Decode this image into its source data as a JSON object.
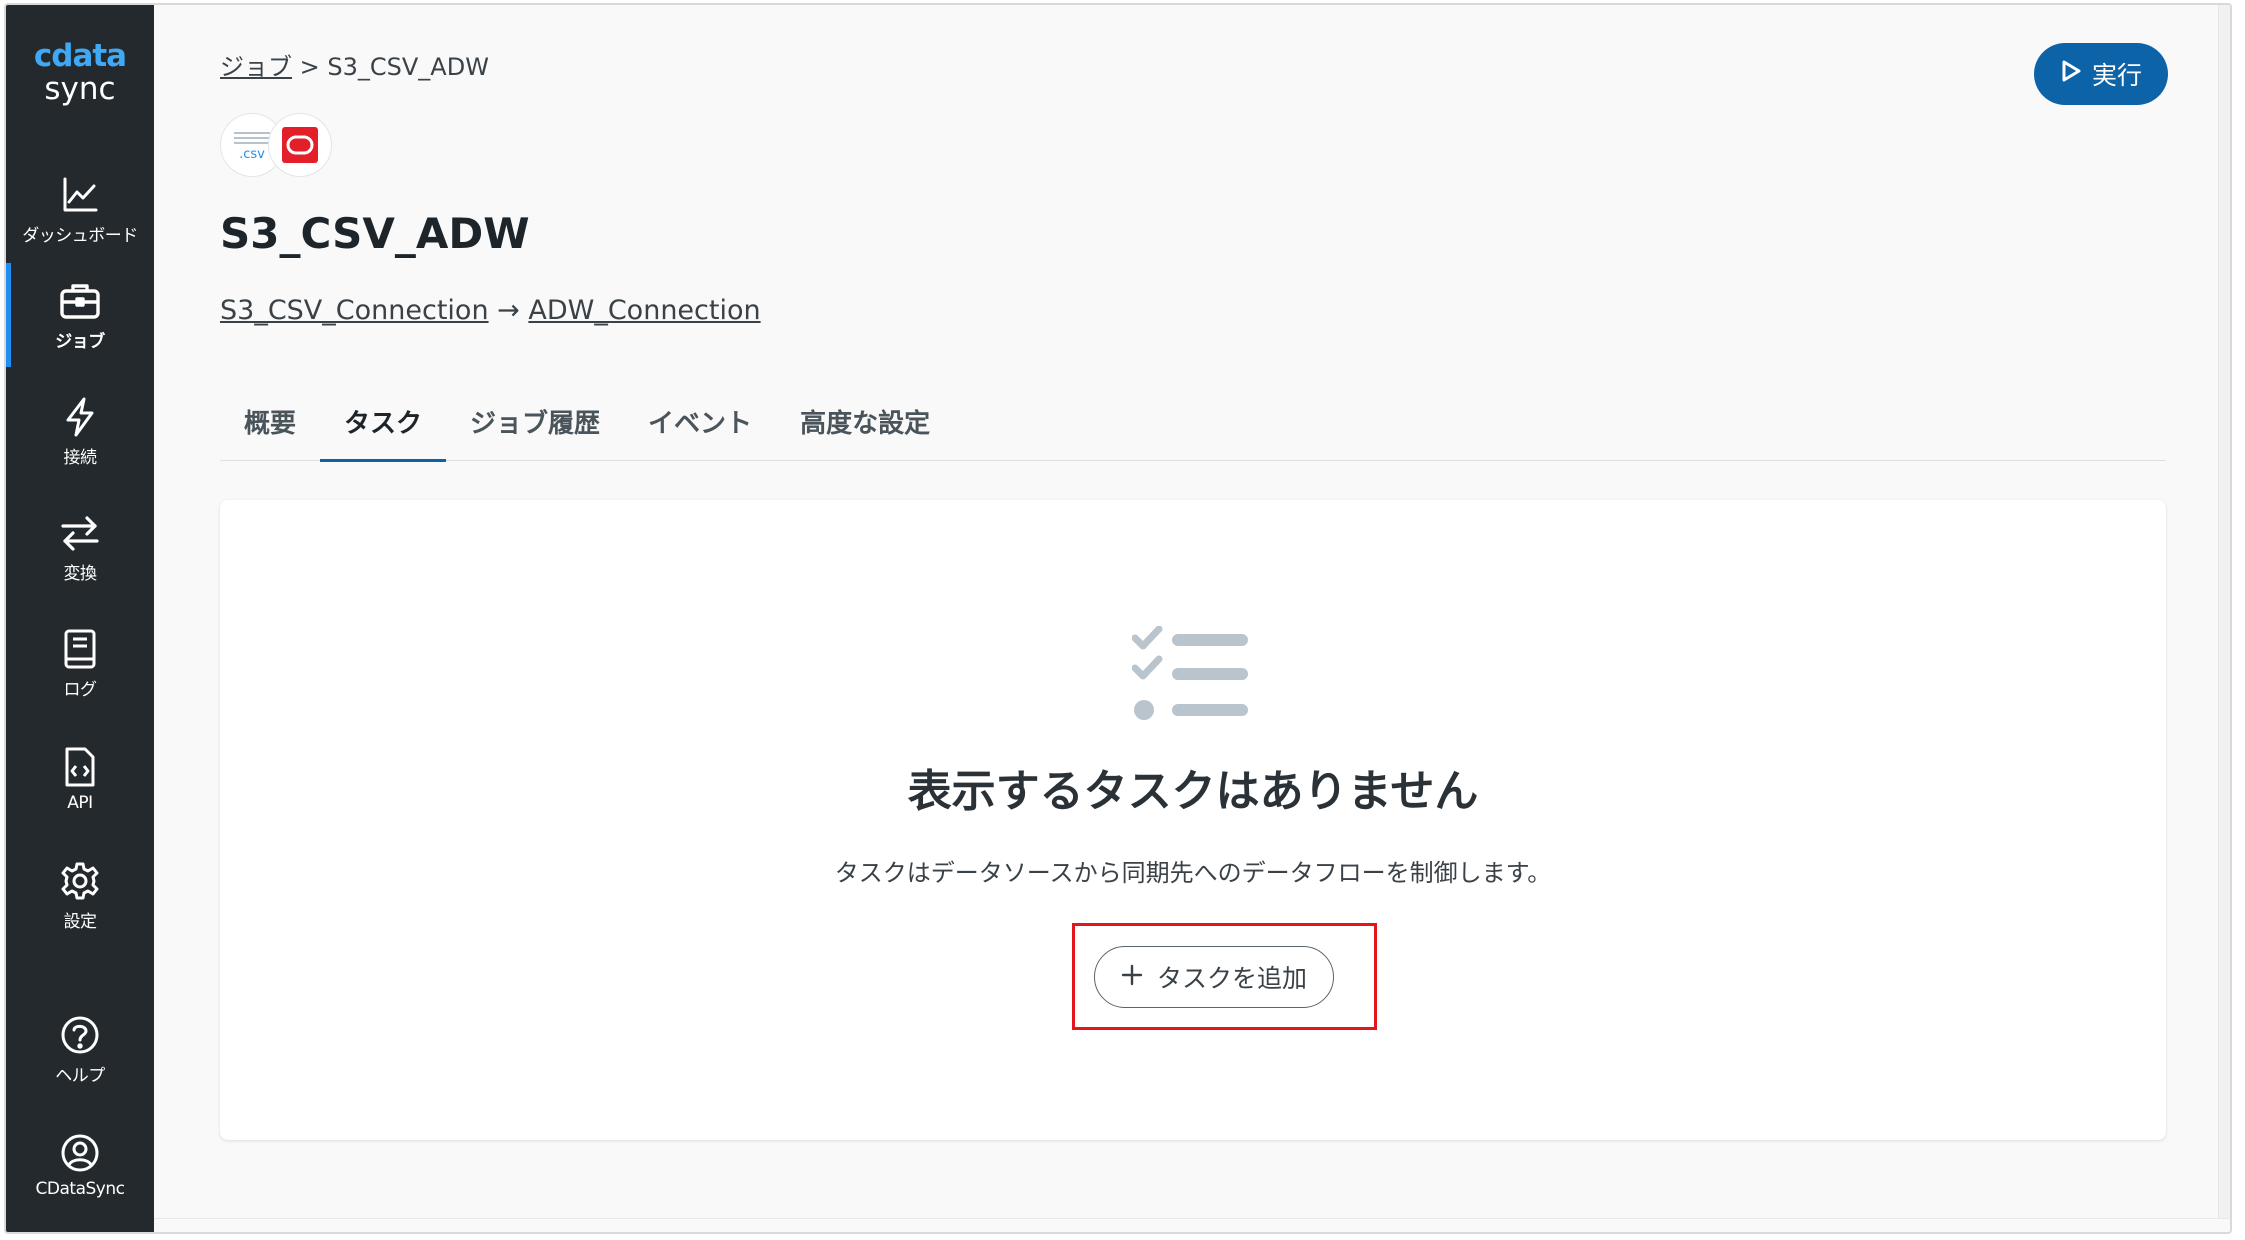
{
  "app": {
    "logo_brand": "cdata",
    "logo_sub": "sync"
  },
  "sidebar": {
    "items": [
      {
        "label": "ダッシュボード",
        "icon": "chart-line-icon"
      },
      {
        "label": "ジョブ",
        "icon": "briefcase-icon",
        "active": true
      },
      {
        "label": "接続",
        "icon": "lightning-icon"
      },
      {
        "label": "変換",
        "icon": "arrows-swap-icon"
      },
      {
        "label": "ログ",
        "icon": "book-icon"
      },
      {
        "label": "API",
        "icon": "code-file-icon"
      },
      {
        "label": "設定",
        "icon": "gear-icon"
      },
      {
        "label": "ヘルプ",
        "icon": "help-circle-icon"
      },
      {
        "label": "CDataSync",
        "icon": "user-circle-icon"
      }
    ]
  },
  "breadcrumb": {
    "parent": "ジョブ",
    "separator": ">",
    "current": "S3_CSV_ADW"
  },
  "header": {
    "run_label": "実行",
    "source_icon_text": ".csv",
    "title": "S3_CSV_ADW"
  },
  "connections": {
    "source": "S3_CSV_Connection",
    "arrow": "→",
    "destination": "ADW_Connection"
  },
  "tabs": [
    {
      "label": "概要"
    },
    {
      "label": "タスク",
      "active": true
    },
    {
      "label": "ジョブ履歴"
    },
    {
      "label": "イベント"
    },
    {
      "label": "高度な設定"
    }
  ],
  "empty_state": {
    "title": "表示するタスクはありません",
    "description": "タスクはデータソースから同期先へのデータフローを制御します。",
    "add_button_label": "タスクを追加"
  },
  "colors": {
    "sidebar_bg": "#24292d",
    "accent": "#0d63a8",
    "active_indicator": "#1f8ff2",
    "highlight": "#e4151b",
    "oracle_red": "#e3202a"
  }
}
